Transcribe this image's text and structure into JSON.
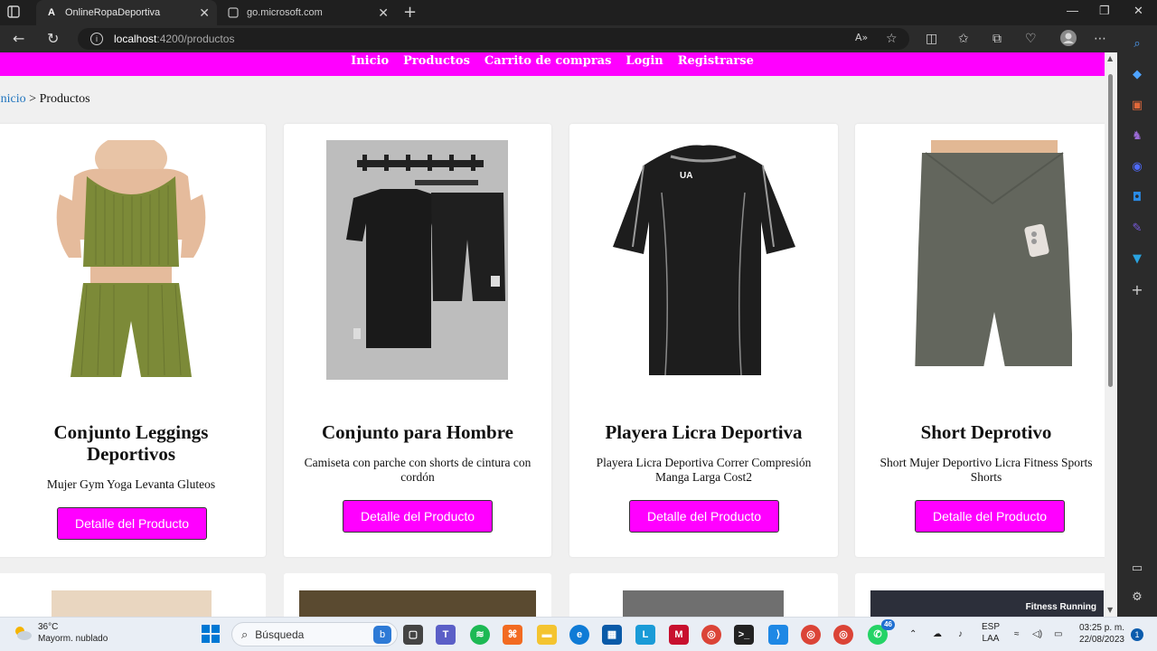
{
  "browser": {
    "tabs": [
      {
        "title": "OnlineRopaDeportiva",
        "favicon": "A",
        "active": true
      },
      {
        "title": "go.microsoft.com",
        "favicon": "",
        "active": false
      }
    ],
    "url_host": "localhost",
    "url_path": ":4200/productos",
    "read_aloud_label": "A»"
  },
  "nav": {
    "items": [
      {
        "label": "Inicio"
      },
      {
        "label": "Productos"
      },
      {
        "label": "Carrito de compras"
      },
      {
        "label": "Login"
      },
      {
        "label": "Registrarse"
      }
    ],
    "color": "#ff00ff"
  },
  "breadcrumb": {
    "link": "Inicio",
    "separator": " > ",
    "current": "Productos"
  },
  "products": [
    {
      "title_line1": "Conjunto Leggings",
      "title_line2": "Deportivos",
      "desc": "Mujer Gym Yoga Levanta Gluteos",
      "button": "Detalle del Producto"
    },
    {
      "title_line1": "Conjunto para Hombre",
      "title_line2": "",
      "desc": "Camiseta con parche con shorts de cintura con cordón",
      "button": "Detalle del Producto"
    },
    {
      "title_line1": "Playera Licra Deportiva",
      "title_line2": "",
      "desc": "Playera Licra Deportiva Correr Compresión Manga Larga Cost2",
      "button": "Detalle del Producto"
    },
    {
      "title_line1": "Short Deprotivo",
      "title_line2": "",
      "desc": "Short Mujer Deportivo Licra Fitness Sports Shorts",
      "button": "Detalle del Producto"
    }
  ],
  "second_row_overlay_text": "Fitness Running",
  "taskbar": {
    "weather_temp": "36°C",
    "weather_desc": "Mayorm. nublado",
    "search_placeholder": "Búsqueda",
    "lang_top": "ESP",
    "lang_bottom": "LAA",
    "time": "03:25 p. m.",
    "date": "22/08/2023",
    "whatsapp_badge": "46",
    "notif_count": "1"
  }
}
